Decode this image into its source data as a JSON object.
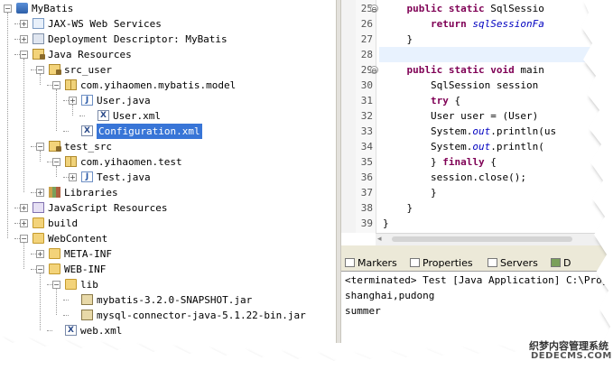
{
  "tree": {
    "items": [
      {
        "label": "MyBatis",
        "icon": "project-icon",
        "toggle": "−"
      },
      {
        "label": "JAX-WS Web Services",
        "icon": "web-services-icon",
        "toggle": "+"
      },
      {
        "label": "Deployment Descriptor: MyBatis",
        "icon": "deployment-descriptor-icon",
        "toggle": "+"
      },
      {
        "label": "Java Resources",
        "icon": "java-resources-icon",
        "toggle": "−"
      },
      {
        "label": "src_user",
        "icon": "source-folder-icon",
        "toggle": "−"
      },
      {
        "label": "com.yihaomen.mybatis.model",
        "icon": "package-icon",
        "toggle": "−"
      },
      {
        "label": "User.java",
        "icon": "java-file-icon",
        "toggle": "+"
      },
      {
        "label": "User.xml",
        "icon": "xml-file-icon",
        "toggle": ""
      },
      {
        "label": "Configuration.xml",
        "icon": "xml-file-icon",
        "toggle": "",
        "selected": true
      },
      {
        "label": "test_src",
        "icon": "source-folder-icon",
        "toggle": "−"
      },
      {
        "label": "com.yihaomen.test",
        "icon": "package-icon",
        "toggle": "−"
      },
      {
        "label": "Test.java",
        "icon": "java-file-icon",
        "toggle": "+"
      },
      {
        "label": "Libraries",
        "icon": "libraries-icon",
        "toggle": "+"
      },
      {
        "label": "JavaScript Resources",
        "icon": "javascript-resources-icon",
        "toggle": "+"
      },
      {
        "label": "build",
        "icon": "folder-icon",
        "toggle": "+"
      },
      {
        "label": "WebContent",
        "icon": "folder-icon",
        "toggle": "−"
      },
      {
        "label": "META-INF",
        "icon": "folder-icon",
        "toggle": "+"
      },
      {
        "label": "WEB-INF",
        "icon": "folder-icon",
        "toggle": "−"
      },
      {
        "label": "lib",
        "icon": "folder-icon",
        "toggle": "−"
      },
      {
        "label": "mybatis-3.2.0-SNAPSHOT.jar",
        "icon": "jar-file-icon",
        "toggle": ""
      },
      {
        "label": "mysql-connector-java-5.1.22-bin.jar",
        "icon": "jar-file-icon",
        "toggle": ""
      },
      {
        "label": "web.xml",
        "icon": "xml-file-icon",
        "toggle": ""
      }
    ]
  },
  "editor": {
    "line_numbers": [
      "25",
      "26",
      "27",
      "28",
      "29",
      "30",
      "31",
      "32",
      "33",
      "34",
      "35",
      "36",
      "37",
      "38",
      "39"
    ],
    "fold_markers": [
      {
        "line": "25",
        "glyph": "⊖"
      },
      {
        "line": "29",
        "glyph": "⊖"
      }
    ],
    "lines": [
      [
        {
          "t": "    "
        },
        {
          "t": "public",
          "c": "kw"
        },
        {
          "t": " "
        },
        {
          "t": "static",
          "c": "kw"
        },
        {
          "t": " SqlSessio"
        }
      ],
      [
        {
          "t": "        "
        },
        {
          "t": "return",
          "c": "kw"
        },
        {
          "t": " "
        },
        {
          "t": "sqlSessionFa",
          "c": "it"
        }
      ],
      [
        {
          "t": "    }"
        }
      ],
      [
        {
          "t": ""
        }
      ],
      [
        {
          "t": "    "
        },
        {
          "t": "public",
          "c": "kw"
        },
        {
          "t": " "
        },
        {
          "t": "static",
          "c": "kw"
        },
        {
          "t": " "
        },
        {
          "t": "void",
          "c": "kw"
        },
        {
          "t": " main"
        }
      ],
      [
        {
          "t": "        SqlSession session"
        }
      ],
      [
        {
          "t": "        "
        },
        {
          "t": "try",
          "c": "kw"
        },
        {
          "t": " {"
        }
      ],
      [
        {
          "t": "        User user = (User)"
        }
      ],
      [
        {
          "t": "        System."
        },
        {
          "t": "out",
          "c": "fld"
        },
        {
          "t": ".println(us"
        }
      ],
      [
        {
          "t": "        System."
        },
        {
          "t": "out",
          "c": "fld"
        },
        {
          "t": ".println("
        }
      ],
      [
        {
          "t": "        } "
        },
        {
          "t": "finally",
          "c": "kw"
        },
        {
          "t": " {"
        }
      ],
      [
        {
          "t": "        session.close();"
        }
      ],
      [
        {
          "t": "        }"
        }
      ],
      [
        {
          "t": "    }"
        }
      ],
      [
        {
          "t": "}"
        }
      ]
    ]
  },
  "console_tabs": [
    {
      "label": "Markers",
      "icon": "markers-icon"
    },
    {
      "label": "Properties",
      "icon": "properties-icon"
    },
    {
      "label": "Servers",
      "icon": "servers-icon"
    },
    {
      "label": "D",
      "icon": "data-source-icon"
    }
  ],
  "console": {
    "header": "<terminated> Test [Java Application] C:\\Prog",
    "lines": [
      "shanghai,pudong",
      "summer"
    ]
  },
  "watermark": {
    "line1": "织梦内容管理系统",
    "line2": "DEDECMS.COM"
  }
}
